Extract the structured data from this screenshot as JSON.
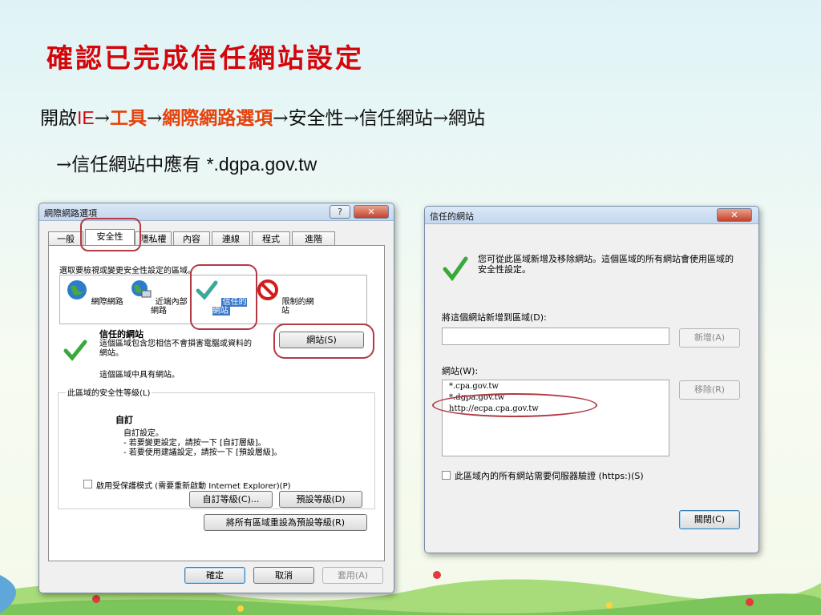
{
  "slide": {
    "title": "確認已完成信任網站設定",
    "path": {
      "open": "開啟",
      "ie": "IE",
      "arrow": "→",
      "tools": "工具",
      "internet_options": "網際網路選項",
      "security": "安全性",
      "trusted_sites": "信任網站",
      "sites": "網站",
      "line2_prefix": "信任網站中應有 ",
      "line2_value": "*.dgpa.gov.tw"
    }
  },
  "internet_options": {
    "title": "網際網路選項",
    "help_glyph": "?",
    "close_glyph": "✕",
    "tabs": [
      "一般",
      "安全性",
      "隱私權",
      "內容",
      "連線",
      "程式",
      "進階"
    ],
    "zone_prompt": "選取要檢視或變更安全性設定的區域。",
    "zones": [
      "網際網路",
      "近端內部網路",
      "信任的網站",
      "限制的網站"
    ],
    "zone_title": "信任的網站",
    "zone_desc": "這個區域包含您相信不會損害電腦或資料的網站。",
    "zone_note": "這個區域中具有網站。",
    "sites_button": "網站(S)",
    "security_level_label": "此區域的安全性等級(L)",
    "custom_title": "自訂",
    "custom_line1": "自訂設定。",
    "custom_line2": "- 若要變更設定，請按一下 [自訂層級]。",
    "custom_line3": "- 若要使用建議設定，請按一下 [預設層級]。",
    "protected_mode": "啟用受保護模式 (需要重新啟動 Internet Explorer)(P)",
    "custom_level_button": "自訂等級(C)...",
    "default_level_button": "預設等級(D)",
    "reset_all_button": "將所有區域重設為預設等級(R)",
    "ok_button": "確定",
    "cancel_button": "取消",
    "apply_button": "套用(A)"
  },
  "trusted_sites": {
    "title": "信任的網站",
    "close_glyph": "✕",
    "info": "您可從此區域新增及移除網站。這個區域的所有網站會使用區域的安全性設定。",
    "add_label": "將這個網站新增到區域(D):",
    "add_value": "",
    "add_button": "新增(A)",
    "websites_label": "網站(W):",
    "websites": [
      "*.cpa.gov.tw",
      "*.dgpa.gov.tw",
      "http://ecpa.cpa.gov.tw"
    ],
    "remove_button": "移除(R)",
    "https_label": "此區域內的所有網站需要伺服器驗證 (https:)(S)",
    "close_button": "關閉(C)"
  },
  "colors": {
    "title_red": "#d4060a",
    "option_orange": "#e5410b",
    "callout": "#b23a44",
    "check_green": "#3aa83a"
  }
}
